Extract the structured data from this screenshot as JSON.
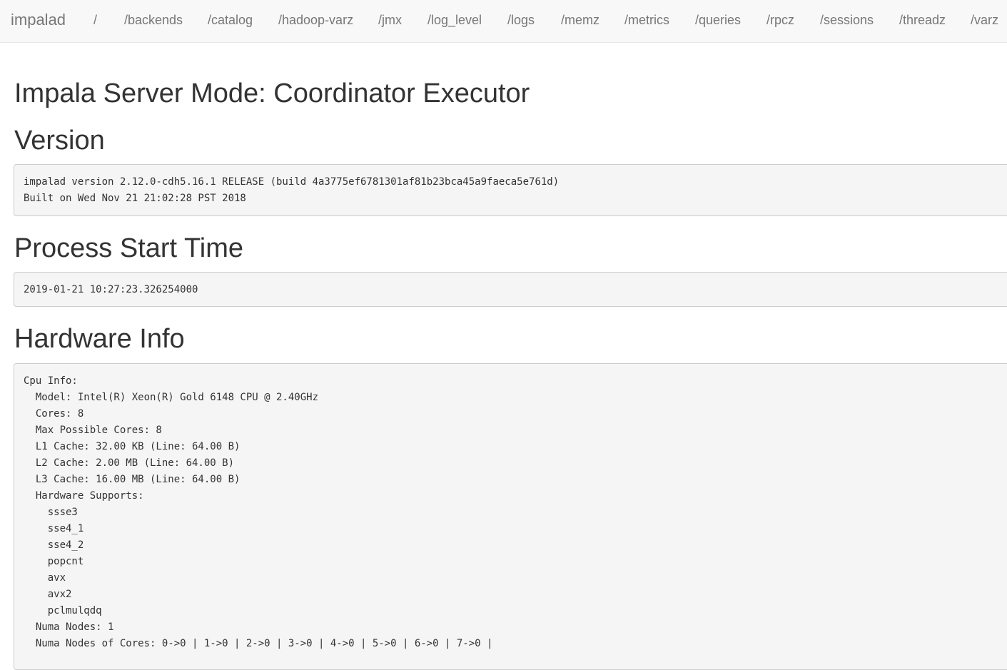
{
  "navbar": {
    "brand": "impalad",
    "links": [
      "/",
      "/backends",
      "/catalog",
      "/hadoop-varz",
      "/jmx",
      "/log_level",
      "/logs",
      "/memz",
      "/metrics",
      "/queries",
      "/rpcz",
      "/sessions",
      "/threadz",
      "/varz"
    ]
  },
  "main": {
    "title": "Impala Server Mode: Coordinator Executor",
    "version": {
      "heading": "Version",
      "lines": [
        "impalad version 2.12.0-cdh5.16.1 RELEASE (build 4a3775ef6781301af81b23bca45a9faeca5e761d)",
        "Built on Wed Nov 21 21:02:28 PST 2018"
      ]
    },
    "process_start": {
      "heading": "Process Start Time",
      "value": "2019-01-21 10:27:23.326254000"
    },
    "hardware": {
      "heading": "Hardware Info",
      "lines": [
        "Cpu Info:",
        "  Model: Intel(R) Xeon(R) Gold 6148 CPU @ 2.40GHz",
        "  Cores: 8",
        "  Max Possible Cores: 8",
        "  L1 Cache: 32.00 KB (Line: 64.00 B)",
        "  L2 Cache: 2.00 MB (Line: 64.00 B)",
        "  L3 Cache: 16.00 MB (Line: 64.00 B)",
        "  Hardware Supports:",
        "    ssse3",
        "    sse4_1",
        "    sse4_2",
        "    popcnt",
        "    avx",
        "    avx2",
        "    pclmulqdq",
        "  Numa Nodes: 1",
        "  Numa Nodes of Cores: 0->0 | 1->0 | 2->0 | 3->0 | 4->0 | 5->0 | 6->0 | 7->0 |"
      ]
    }
  }
}
